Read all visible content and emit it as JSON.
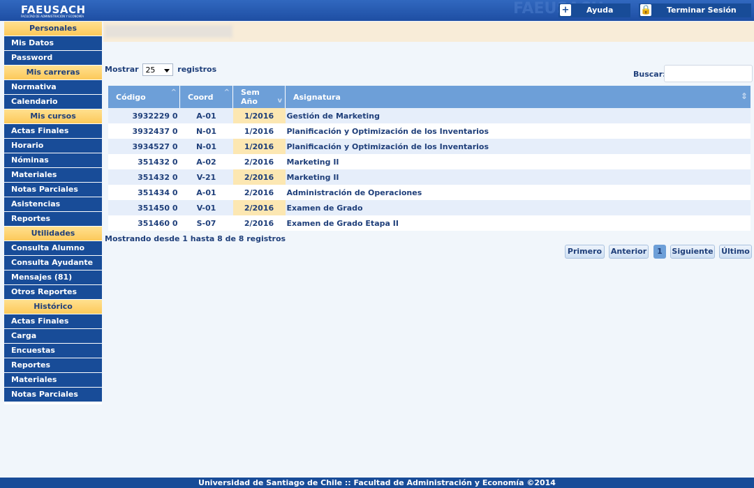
{
  "header": {
    "logo_text": "FAEUSACH",
    "logo_subtext": "FACULTAD DE ADMINISTRACIÓN Y ECONOMÍA",
    "watermark_text": "FAEUSACH",
    "help_label": "Ayuda",
    "logout_label": "Terminar Sesión"
  },
  "sidebar": {
    "sections": [
      {
        "title": "Personales",
        "items": [
          "Mis Datos",
          "Password"
        ]
      },
      {
        "title": "Mis carreras",
        "items": [
          "Normativa",
          "Calendario"
        ]
      },
      {
        "title": "Mis cursos",
        "items": [
          "Actas Finales",
          "Horario",
          "Nóminas",
          "Materiales",
          "Notas Parciales",
          "Asistencias",
          "Reportes"
        ]
      },
      {
        "title": "Utilidades",
        "items": [
          "Consulta Alumno",
          "Consulta Ayudante",
          "Mensajes (81)",
          "Otros Reportes"
        ]
      },
      {
        "title": "Histórico",
        "items": [
          "Actas Finales",
          "Carga",
          "Encuestas",
          "Reportes",
          "Materiales",
          "Notas Parciales"
        ]
      }
    ]
  },
  "controls": {
    "show_label": "Mostrar",
    "show_value": "25",
    "records_label": "registros",
    "search_label": "Buscar:",
    "search_value": ""
  },
  "table": {
    "headers": {
      "codigo": "Código",
      "coord": "Coord",
      "sem_line1": "Sem",
      "sem_line2": "Año",
      "asignatura": "Asignatura"
    },
    "rows": [
      {
        "codigo": "3932229 0",
        "coord": "A-01",
        "sem": "1/2016",
        "asignatura": "Gestión de Marketing"
      },
      {
        "codigo": "3932437 0",
        "coord": "N-01",
        "sem": "1/2016",
        "asignatura": "Planificación y Optimización de los Inventarios"
      },
      {
        "codigo": "3934527 0",
        "coord": "N-01",
        "sem": "1/2016",
        "asignatura": "Planificación y Optimización de los Inventarios"
      },
      {
        "codigo": "351432 0",
        "coord": "A-02",
        "sem": "2/2016",
        "asignatura": "Marketing II"
      },
      {
        "codigo": "351432 0",
        "coord": "V-21",
        "sem": "2/2016",
        "asignatura": "Marketing II"
      },
      {
        "codigo": "351434 0",
        "coord": "A-01",
        "sem": "2/2016",
        "asignatura": "Administración de Operaciones"
      },
      {
        "codigo": "351450 0",
        "coord": "V-01",
        "sem": "2/2016",
        "asignatura": "Examen de Grado"
      },
      {
        "codigo": "351460 0",
        "coord": "S-07",
        "sem": "2/2016",
        "asignatura": "Examen de Grado Etapa II"
      }
    ]
  },
  "info_text": "Mostrando desde 1 hasta 8 de 8 registros",
  "pagination": {
    "first": "Primero",
    "prev": "Anterior",
    "current": "1",
    "next": "Siguiente",
    "last": "Último"
  },
  "footer": "Universidad de Santiago de Chile :: Facultad de Administración y Economía ©2014",
  "colors": {
    "header_blue": "#1e4ea3",
    "nav_blue": "#184c98",
    "section_yellow": "#fcc95a",
    "table_header": "#6d9fd8",
    "highlight": "#fce7b2"
  }
}
